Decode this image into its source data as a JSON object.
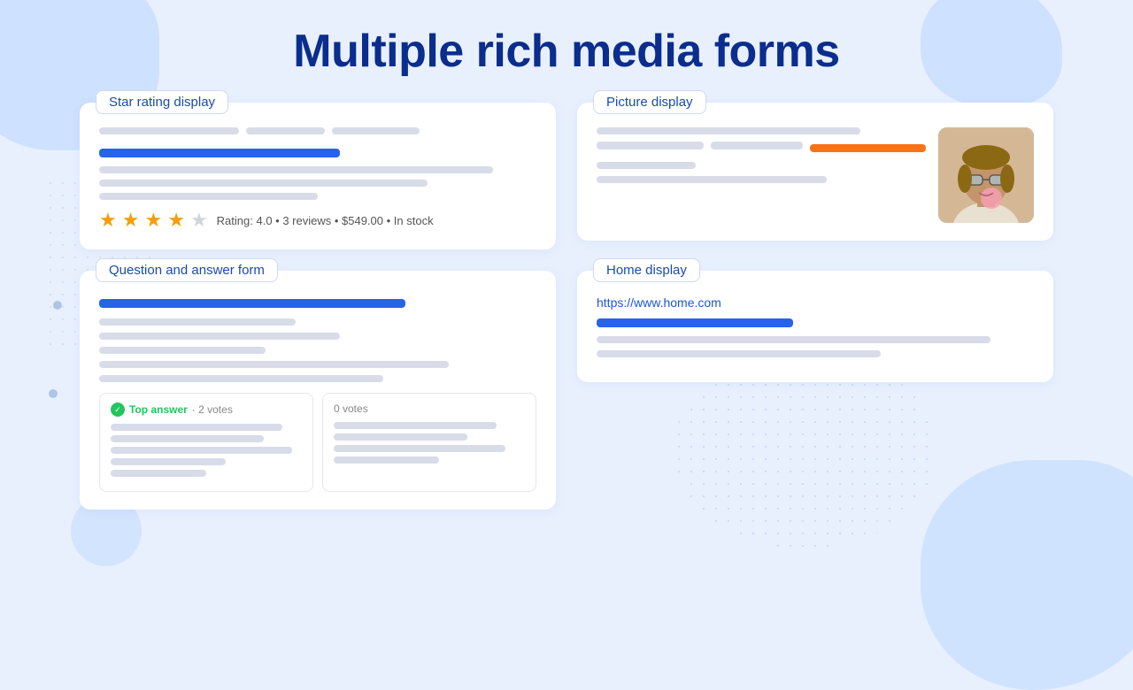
{
  "page": {
    "title": "Multiple rich media forms"
  },
  "cards": {
    "star_rating": {
      "label": "Star rating display",
      "rating_text": "Rating: 4.0  •  3 reviews  •  $549.00  •  In stock",
      "stars": [
        true,
        true,
        true,
        true,
        false
      ]
    },
    "picture_display": {
      "label": "Picture display"
    },
    "qa_form": {
      "label": "Question and answer form",
      "top_answer_label": "Top answer",
      "top_votes": "· 2 votes",
      "other_votes": "0 votes"
    },
    "home_display": {
      "label": "Home display",
      "url": "https://www.home.com"
    }
  }
}
